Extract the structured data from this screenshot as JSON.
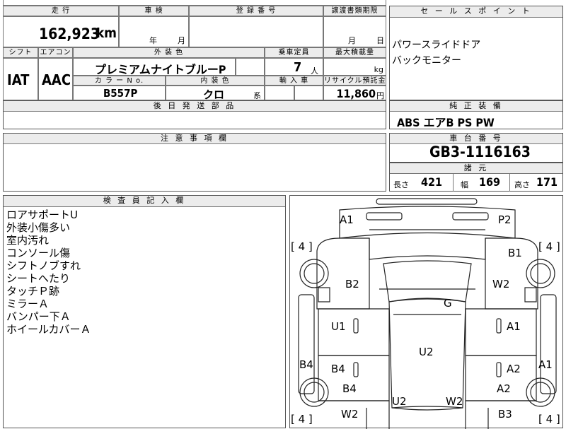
{
  "top_row": {
    "mileage_header": "走 行",
    "inspection_header": "車 検",
    "registration_header": "登 録 番 号",
    "transfer_header": "譲渡書類期限",
    "mileage_value": "162,923",
    "mileage_unit": "km",
    "year_label": "年",
    "month_label": "月",
    "transfer_month_label": "月",
    "transfer_day_label": "日"
  },
  "spec_row": {
    "shift_header": "シフト",
    "ac_header": "エアコン",
    "exterior_header": "外 装 色",
    "capacity_header": "乗車定員",
    "max_load_header": "最大積載量",
    "shift_value": "IAT",
    "ac_value": "AAC",
    "exterior_value": "プレミアムナイトブルーP",
    "capacity_value": "7",
    "capacity_unit": "人",
    "load_unit": "kg",
    "color_no_header": "カ ラ ー N o.",
    "interior_header": "内 装 色",
    "import_header": "輸 入 車",
    "recycle_header": "リサイクル預託金",
    "color_no_value": "B557P",
    "interior_value": "クロ",
    "interior_suffix": "系",
    "recycle_value": "11,860",
    "recycle_unit": "円"
  },
  "parts_header": "後 日 発 送 部 品",
  "notes_header": "注 意 事 項 欄",
  "sales": {
    "header": "セ ー ル ス ポ イ ン ト",
    "line1": "パワースライドドア",
    "line2": "バックモニター"
  },
  "genuine": {
    "header": "純 正 装 備",
    "value": "ABS エアB PS PW"
  },
  "chassis": {
    "header": "車 台 番 号",
    "value": "GB3-1116163"
  },
  "dims": {
    "header": "諸 元",
    "length_label": "長さ",
    "length_value": "421",
    "width_label": "幅",
    "width_value": "169",
    "height_label": "高さ",
    "height_value": "171"
  },
  "inspector": {
    "header": "検 査 員 記 入 欄",
    "remarks": [
      "ロアサポートU",
      "外装小傷多い",
      "室内汚れ",
      "コンソール傷",
      "シフトノブすれ",
      "シートへたり",
      "タッチＰ跡",
      "ミラーＡ",
      "バンパー下Ａ",
      "ホイールカバーＡ"
    ]
  },
  "diagram": {
    "tires": [
      "[ 4 ]",
      "[ 4 ]",
      "[ 4 ]",
      "[ 4 ]"
    ],
    "marks": {
      "front_left": "A1",
      "front_right": "P2",
      "b2": "B2",
      "b1": "B1",
      "w2_right": "W2",
      "g": "G",
      "u1": "U1",
      "a1_door": "A1",
      "u2_roof": "U2",
      "b4_side": "B4",
      "b4_door": "B4",
      "a2_door": "A2",
      "a1_side": "A1",
      "b4_rear": "B4",
      "a2_rear": "A2",
      "w2_left": "W2",
      "u2_rear": "U2",
      "w2_rear": "W2",
      "b3": "B3"
    }
  }
}
